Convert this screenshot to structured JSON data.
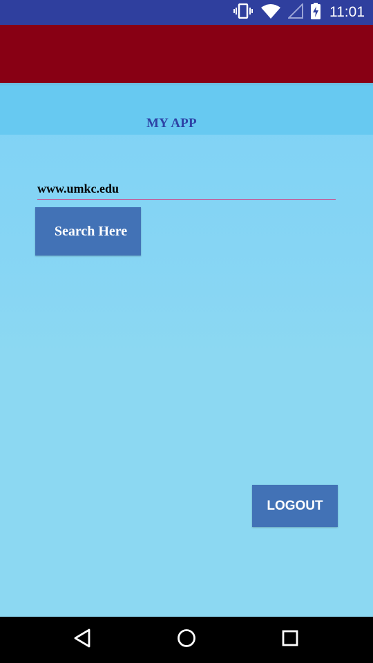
{
  "status_bar": {
    "time": "11:01",
    "icons": [
      "vibrate-icon",
      "wifi-icon",
      "signal-icon",
      "battery-charging-icon"
    ]
  },
  "toolbar": {
    "color": "#880014"
  },
  "main": {
    "title": "MY APP",
    "url_input_value": "www.umkc.edu",
    "search_button_label": "Search Here",
    "logout_button_label": "LOGOUT"
  },
  "nav_bar": {
    "buttons": [
      "back-icon",
      "home-icon",
      "recents-icon"
    ]
  },
  "colors": {
    "status_bar": "#2f3f9e",
    "toolbar": "#880014",
    "background": "#8cd8f2",
    "title_band": "#67c9f1",
    "title_text": "#2e43a6",
    "button": "#4272b6",
    "input_underline": "#d6377c"
  }
}
